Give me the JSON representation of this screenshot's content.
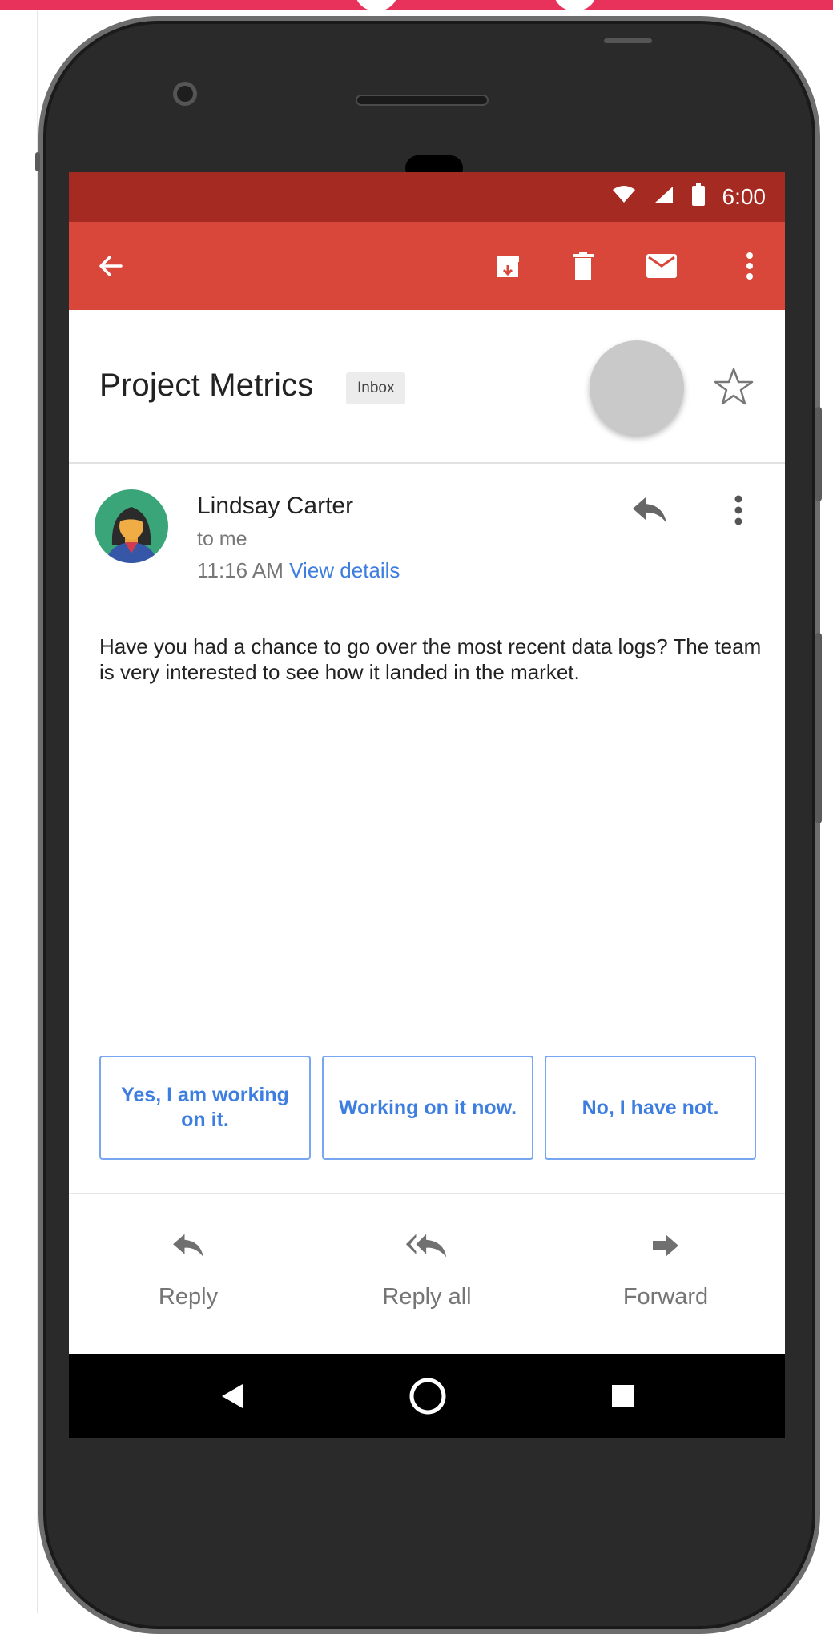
{
  "status_bar": {
    "time": "6:00",
    "icons": [
      "wifi-icon",
      "cell-signal-icon",
      "battery-icon"
    ]
  },
  "toolbar": {
    "icons": [
      "back-arrow-icon",
      "archive-icon",
      "delete-icon",
      "mark-unread-icon",
      "more-vert-icon"
    ]
  },
  "email": {
    "subject": "Project Metrics",
    "label": "Inbox",
    "sender": "Lindsay Carter",
    "recipient": "to me",
    "time": "11:16 AM",
    "view_details": "View details",
    "body": "Have you had a chance to go over the most recent data logs? The team is very interested to see how it landed in the market."
  },
  "smart_replies": [
    {
      "label": "Yes, I am working on it."
    },
    {
      "label": "Working on it now."
    },
    {
      "label": "No, I have not."
    }
  ],
  "actions": [
    {
      "label": "Reply",
      "icon": "reply-icon"
    },
    {
      "label": "Reply all",
      "icon": "reply-all-icon"
    },
    {
      "label": "Forward",
      "icon": "forward-icon"
    }
  ],
  "nav": {
    "icons": [
      "nav-back-icon",
      "nav-home-icon",
      "nav-recents-icon"
    ]
  },
  "colors": {
    "status_bar": "#a52b22",
    "app_bar": "#d9473a",
    "accent_blue": "#3d7ee0",
    "page_strip": "#e8315b"
  }
}
